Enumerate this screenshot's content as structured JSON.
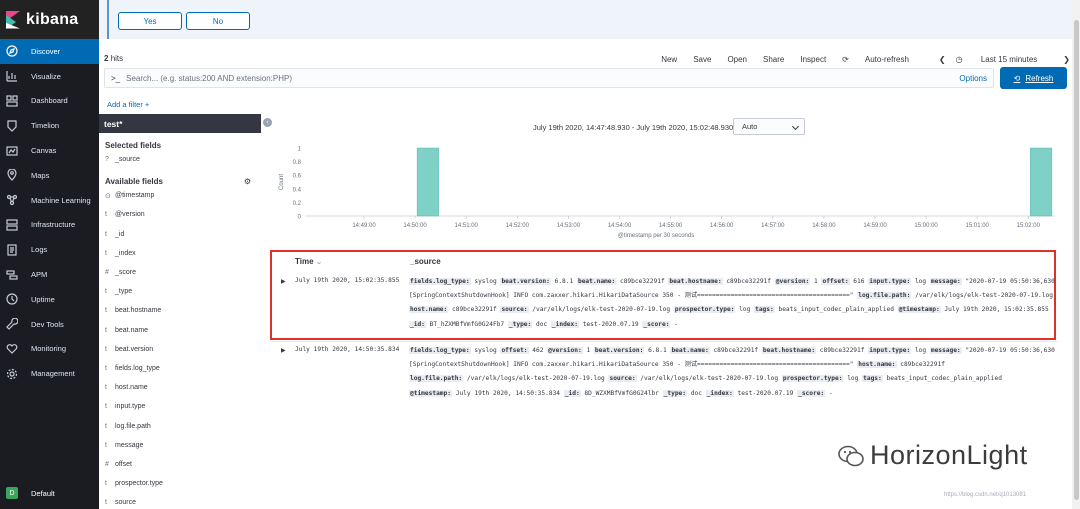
{
  "app": {
    "brand": "kibana"
  },
  "sidebar": {
    "items": [
      {
        "label": "Discover",
        "icon": "compass-icon",
        "active": true
      },
      {
        "label": "Visualize",
        "icon": "chart-icon"
      },
      {
        "label": "Dashboard",
        "icon": "dashboard-icon"
      },
      {
        "label": "Timelion",
        "icon": "shield-icon"
      },
      {
        "label": "Canvas",
        "icon": "canvas-icon"
      },
      {
        "label": "Maps",
        "icon": "map-icon"
      },
      {
        "label": "Machine Learning",
        "icon": "ml-icon"
      },
      {
        "label": "Infrastructure",
        "icon": "infra-icon"
      },
      {
        "label": "Logs",
        "icon": "logs-icon"
      },
      {
        "label": "APM",
        "icon": "apm-icon"
      },
      {
        "label": "Uptime",
        "icon": "uptime-icon"
      },
      {
        "label": "Dev Tools",
        "icon": "wrench-icon"
      },
      {
        "label": "Monitoring",
        "icon": "heart-icon"
      },
      {
        "label": "Management",
        "icon": "gear-icon"
      }
    ],
    "space": {
      "badge": "D",
      "label": "Default"
    }
  },
  "callout": {
    "yes_label": "Yes",
    "no_label": "No"
  },
  "toolbar": {
    "hits_count": "2",
    "hits_suffix": "hits",
    "links": [
      "New",
      "Save",
      "Open",
      "Share",
      "Inspect"
    ],
    "auto_refresh": "Auto-refresh",
    "time_label": "Last 15 minutes"
  },
  "query": {
    "prompt": ">_",
    "placeholder": "Search... (e.g. status:200 AND extension:PHP)",
    "options": "Options",
    "refresh": "Refresh"
  },
  "add_filter": "Add a filter +",
  "fields_panel": {
    "index": "test*",
    "selected_title": "Selected fields",
    "selected": [
      {
        "type": "?",
        "name": "_source"
      }
    ],
    "available_title": "Available fields",
    "available": [
      {
        "type": "⊙",
        "name": "@timestamp"
      },
      {
        "type": "t",
        "name": "@version"
      },
      {
        "type": "t",
        "name": "_id"
      },
      {
        "type": "t",
        "name": "_index"
      },
      {
        "type": "#",
        "name": "_score"
      },
      {
        "type": "t",
        "name": "_type"
      },
      {
        "type": "t",
        "name": "beat.hostname"
      },
      {
        "type": "t",
        "name": "beat.name"
      },
      {
        "type": "t",
        "name": "beat.version"
      },
      {
        "type": "t",
        "name": "fields.log_type"
      },
      {
        "type": "t",
        "name": "host.name"
      },
      {
        "type": "t",
        "name": "input.type"
      },
      {
        "type": "t",
        "name": "log.file.path"
      },
      {
        "type": "t",
        "name": "message"
      },
      {
        "type": "#",
        "name": "offset"
      },
      {
        "type": "t",
        "name": "prospector.type"
      },
      {
        "type": "t",
        "name": "source"
      }
    ]
  },
  "histogram": {
    "range": "July 19th 2020, 14:47:48.930 - July 19th 2020, 15:02:48.930 —",
    "interval": "Auto",
    "xlabel": "@timestamp per 30 seconds",
    "ylabel": "Count"
  },
  "chart_data": {
    "type": "bar",
    "xlabel": "@timestamp per 30 seconds",
    "ylabel": "Count",
    "ylim": [
      0,
      1
    ],
    "yticks": [
      "1",
      "0.8",
      "0.6",
      "0.4",
      "0.2",
      "0"
    ],
    "xticks": [
      "14:49:00",
      "14:50:00",
      "14:51:00",
      "14:52:00",
      "14:53:00",
      "14:54:00",
      "14:55:00",
      "14:56:00",
      "14:57:00",
      "14:58:00",
      "14:59:00",
      "15:00:00",
      "15:01:00",
      "15:02:00"
    ],
    "bars": [
      {
        "x": "14:50:30",
        "value": 1
      },
      {
        "x": "15:02:30",
        "value": 1
      }
    ],
    "color": "#7fd1c7"
  },
  "table": {
    "time_header": "Time",
    "source_header": "_source",
    "rows": [
      {
        "time": "July 19th 2020, 15:02:35.855",
        "lines": [
          [
            [
              "fields.log_type:",
              "syslog"
            ],
            [
              "beat.version:",
              "6.8.1"
            ],
            [
              "beat.name:",
              "c89bce32291f"
            ],
            [
              "beat.hostname:",
              "c89bce32291f"
            ],
            [
              "@version:",
              "1"
            ],
            [
              "offset:",
              "616"
            ],
            [
              "input.type:",
              "log"
            ],
            [
              "message:",
              "\"2020-07-19 05:50:36,630"
            ]
          ],
          [
            [
              "",
              "[SpringContextShutdownHook] INFO com.zaxxer.hikari.HikariDataSource 350 - 测试=========================================\""
            ],
            [
              "log.file.path:",
              "/var/elk/logs/elk-test-2020-07-19.log"
            ]
          ],
          [
            [
              "host.name:",
              "c89bce32291f"
            ],
            [
              "source:",
              "/var/elk/logs/elk-test-2020-07-19.log"
            ],
            [
              "prospector.type:",
              "log"
            ],
            [
              "tags:",
              "beats_input_codec_plain_applied"
            ],
            [
              "@timestamp:",
              "July 19th 2020, 15:02:35.855"
            ]
          ],
          [
            [
              "_id:",
              "BT_hZXMBfVmfG0G24Fb7"
            ],
            [
              "_type:",
              "doc"
            ],
            [
              "_index:",
              "test-2020.07.19"
            ],
            [
              "_score:",
              "-"
            ]
          ]
        ]
      },
      {
        "time": "July 19th 2020, 14:50:35.834",
        "lines": [
          [
            [
              "fields.log_type:",
              "syslog"
            ],
            [
              "offset:",
              "462"
            ],
            [
              "@version:",
              "1"
            ],
            [
              "beat.version:",
              "6.8.1"
            ],
            [
              "beat.name:",
              "c89bce32291f"
            ],
            [
              "beat.hostname:",
              "c89bce32291f"
            ],
            [
              "input.type:",
              "log"
            ],
            [
              "message:",
              "\"2020-07-19 05:50:36,630"
            ]
          ],
          [
            [
              "",
              "[SpringContextShutdownHook] INFO com.zaxxer.hikari.HikariDataSource 350 - 测试=========================================\""
            ],
            [
              "host.name:",
              "c89bce32291f"
            ]
          ],
          [
            [
              "log.file.path:",
              "/var/elk/logs/elk-test-2020-07-19.log"
            ],
            [
              "source:",
              "/var/elk/logs/elk-test-2020-07-19.log"
            ],
            [
              "prospector.type:",
              "log"
            ],
            [
              "tags:",
              "beats_input_codec_plain_applied"
            ]
          ],
          [
            [
              "@timestamp:",
              "July 19th 2020, 14:50:35.834"
            ],
            [
              "_id:",
              "8D_WZXMBfVmfG0G24lbr"
            ],
            [
              "_type:",
              "doc"
            ],
            [
              "_index:",
              "test-2020.07.19"
            ],
            [
              "_score:",
              "-"
            ]
          ]
        ]
      }
    ]
  },
  "watermark": {
    "text": "HorizonLight",
    "url": "https://blog.csdn.net/q1013081"
  }
}
